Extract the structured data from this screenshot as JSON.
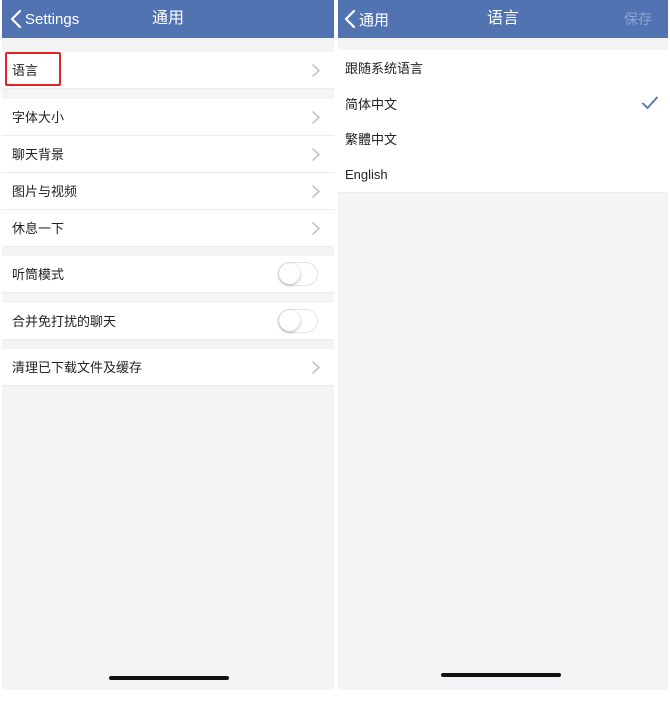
{
  "left_screen": {
    "navbar": {
      "back_label": "Settings",
      "title": "通用"
    },
    "rows": [
      {
        "label": "语言",
        "accessory": "chevron"
      },
      {
        "label": "字体大小",
        "accessory": "chevron"
      },
      {
        "label": "聊天背景",
        "accessory": "chevron"
      },
      {
        "label": "图片与视频",
        "accessory": "chevron"
      },
      {
        "label": "休息一下",
        "accessory": "chevron"
      },
      {
        "label": "听筒模式",
        "accessory": "toggle",
        "toggle_on": false
      },
      {
        "label": "合并免打扰的聊天",
        "accessory": "toggle",
        "toggle_on": false
      },
      {
        "label": "清理已下载文件及缓存",
        "accessory": "chevron"
      }
    ],
    "highlight_color": "#e02424"
  },
  "right_screen": {
    "navbar": {
      "back_label": "通用",
      "title": "语言",
      "save_label": "保存"
    },
    "options": [
      {
        "label": "跟随系统语言",
        "selected": false
      },
      {
        "label": "简体中文",
        "selected": true
      },
      {
        "label": "繁體中文",
        "selected": false
      },
      {
        "label": "English",
        "selected": false
      }
    ]
  },
  "colors": {
    "navbar": "#5173b2",
    "background": "#f4f4f6",
    "checkmark": "#5173b2",
    "save_disabled": "#8ea3cf"
  },
  "icons": {
    "back": "chevron-left-icon",
    "row_accessory": "chevron-right-icon",
    "selected": "checkmark-icon"
  }
}
